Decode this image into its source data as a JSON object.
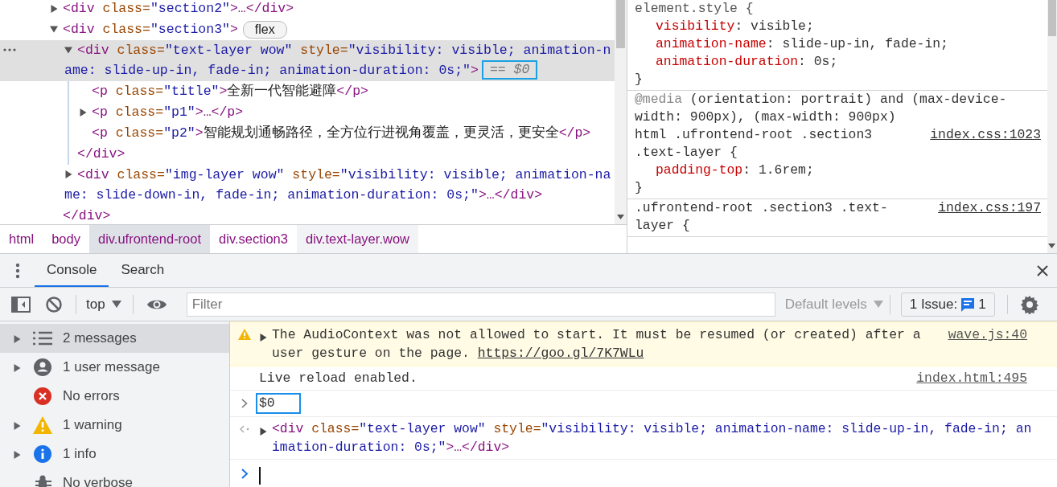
{
  "elements": {
    "nodes": [
      {
        "selected": false,
        "expanded": false,
        "tokens": [
          {
            "kind": "tag",
            "text": "<div"
          },
          {
            "kind": "attr",
            "text": " class="
          },
          {
            "kind": "value",
            "text": "\"section2\""
          },
          {
            "kind": "tag",
            "text": ">…</div>"
          }
        ]
      },
      {
        "selected": false,
        "expanded": true,
        "tokens": [
          {
            "kind": "tag",
            "text": "<div"
          },
          {
            "kind": "attr",
            "text": " class="
          },
          {
            "kind": "value",
            "text": "\"section3\""
          },
          {
            "kind": "tag",
            "text": ">"
          }
        ],
        "badge": "flex",
        "children": [
          {
            "selected": true,
            "expanded": true,
            "tokens": [
              {
                "kind": "tag",
                "text": "<div"
              },
              {
                "kind": "attr",
                "text": " class="
              },
              {
                "kind": "value",
                "text": "\"text-layer wow\""
              },
              {
                "kind": "attr",
                "text": " style="
              },
              {
                "kind": "value",
                "text": "\"visibility: visible; animation-name: slide-up-in, fade-in; animation-duration: 0s;\""
              },
              {
                "kind": "tag",
                "text": ">"
              }
            ],
            "marker": {
              "text": "== $0",
              "highlighted": true
            },
            "children": [
              {
                "selected": false,
                "tokens": [
                  {
                    "kind": "tag",
                    "text": "<p"
                  },
                  {
                    "kind": "attr",
                    "text": " class="
                  },
                  {
                    "kind": "value",
                    "text": "\"title\""
                  },
                  {
                    "kind": "tag",
                    "text": ">"
                  },
                  {
                    "kind": "text",
                    "text": "全新一代智能避障"
                  },
                  {
                    "kind": "tag",
                    "text": "</p>"
                  }
                ]
              },
              {
                "selected": false,
                "expanded": false,
                "tokens": [
                  {
                    "kind": "tag",
                    "text": "<p"
                  },
                  {
                    "kind": "attr",
                    "text": " class="
                  },
                  {
                    "kind": "value",
                    "text": "\"p1\""
                  },
                  {
                    "kind": "tag",
                    "text": ">…</p>"
                  }
                ]
              },
              {
                "selected": false,
                "tokens": [
                  {
                    "kind": "tag",
                    "text": "<p"
                  },
                  {
                    "kind": "attr",
                    "text": " class="
                  },
                  {
                    "kind": "value",
                    "text": "\"p2\""
                  },
                  {
                    "kind": "tag",
                    "text": ">"
                  },
                  {
                    "kind": "text",
                    "text": "智能规划通畅路径，全方位行进视角覆盖，更灵活，更安全"
                  },
                  {
                    "kind": "tag",
                    "text": "</p>"
                  }
                ]
              }
            ],
            "closing": [
              {
                "kind": "tag",
                "text": "</div>"
              }
            ]
          },
          {
            "selected": false,
            "expanded": false,
            "tokens": [
              {
                "kind": "tag",
                "text": "<div"
              },
              {
                "kind": "attr",
                "text": " class="
              },
              {
                "kind": "value",
                "text": "\"img-layer wow\""
              },
              {
                "kind": "attr",
                "text": " style="
              },
              {
                "kind": "value",
                "text": "\"visibility: visible; animation-name: slide-down-in, fade-in; animation-duration: 0s;\""
              },
              {
                "kind": "tag",
                "text": ">…</div>"
              }
            ]
          }
        ],
        "closing": [
          {
            "kind": "tag",
            "text": "</div>"
          }
        ]
      }
    ]
  },
  "breadcrumbs": [
    {
      "text": "html",
      "selected": false,
      "hovered": false
    },
    {
      "text": "body",
      "selected": false,
      "hovered": false
    },
    {
      "text": "div.ufrontend-root",
      "selected": false,
      "hovered": true
    },
    {
      "text": "div.section3",
      "selected": false,
      "hovered": false
    },
    {
      "text": "div.text-layer.wow",
      "selected": true,
      "hovered": false
    }
  ],
  "styles": {
    "rules": [
      {
        "kind": "inline",
        "selector": "element.style {",
        "declarations": [
          {
            "property": "visibility",
            "value": ": visible;"
          },
          {
            "property": "animation-name",
            "value": ": slide-up-in, fade-in;"
          },
          {
            "property": "animation-duration",
            "value": ": 0s;"
          }
        ],
        "closing": "}"
      },
      {
        "kind": "stylesheet",
        "media": {
          "keyword": "@media",
          "query": " (orientation: portrait) and (max-device-width: 900px), (max-width: 900px)"
        },
        "selector": "html .ufrontend-root .section3 .text-layer {",
        "source": "index.css:1023",
        "declarations": [
          {
            "property": "padding-top",
            "value": ": 1.6rem;"
          }
        ],
        "closing": "}"
      },
      {
        "kind": "stylesheet",
        "selector": ".ufrontend-root .section3 .text-layer {",
        "source": "index.css:197"
      }
    ]
  },
  "drawer": {
    "tabs": [
      {
        "label": "Console",
        "selected": true
      },
      {
        "label": "Search",
        "selected": false
      }
    ]
  },
  "toolbar": {
    "context": "top",
    "filter": {
      "placeholder": "Filter"
    },
    "levels": "Default levels",
    "issues": {
      "label": "1 Issue:",
      "count": "1"
    }
  },
  "sidebar": {
    "items": [
      {
        "kind": "messages",
        "label": "2 messages",
        "selected": true,
        "expanded": false
      },
      {
        "kind": "user",
        "label": "1 user message",
        "selected": false,
        "expanded": false
      },
      {
        "kind": "error",
        "label": "No errors",
        "selected": false
      },
      {
        "kind": "warning",
        "label": "1 warning",
        "selected": false,
        "expanded": false
      },
      {
        "kind": "info",
        "label": "1 info",
        "selected": false,
        "expanded": false
      },
      {
        "kind": "verbose",
        "label": "No verbose",
        "selected": false
      }
    ]
  },
  "console": {
    "messages": [
      {
        "kind": "warning",
        "expanded": false,
        "text": "The AudioContext was not allowed to start. It must be resumed (or created) after a user gesture on the page. ",
        "link": "https://goo.gl/7K7WLu",
        "source": "wave.js:40"
      },
      {
        "kind": "log",
        "text": "Live reload enabled.",
        "source": "index.html:495"
      },
      {
        "kind": "command",
        "text": "$0",
        "highlighted": true
      },
      {
        "kind": "result",
        "expanded": false,
        "tokens": [
          {
            "kind": "tag",
            "text": "<div"
          },
          {
            "kind": "attr",
            "text": " class="
          },
          {
            "kind": "value",
            "text": "\"text-layer wow\""
          },
          {
            "kind": "attr",
            "text": " style="
          },
          {
            "kind": "value",
            "text": "\"visibility: visible; animation-name: slide-up-in, fade-in; animation-duration: 0s;\""
          },
          {
            "kind": "tag",
            "text": ">…</div>"
          }
        ]
      }
    ],
    "prompt": {
      "focused": true
    }
  }
}
